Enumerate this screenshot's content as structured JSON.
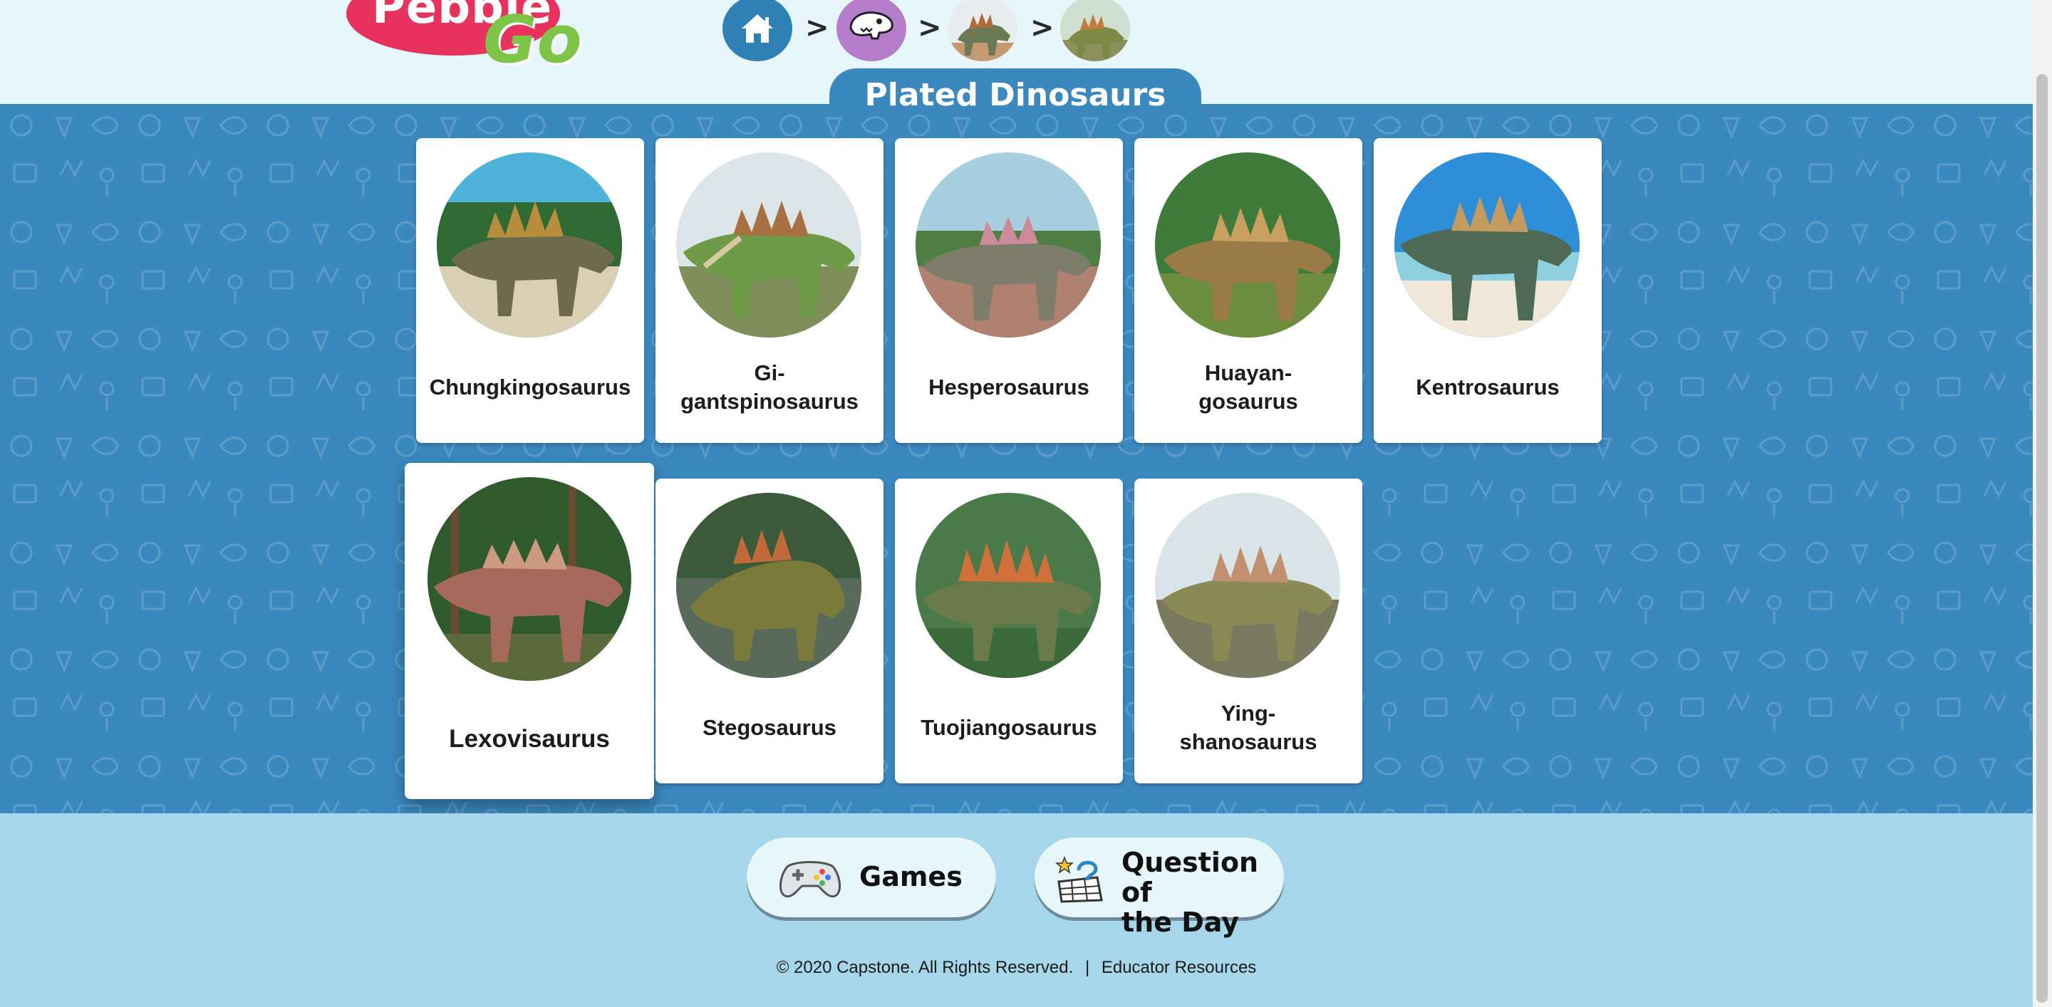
{
  "brand": {
    "logo_top": "Pebble",
    "logo_bottom": "Go"
  },
  "breadcrumb": {
    "separator": ">",
    "items": [
      {
        "icon": "home-icon"
      },
      {
        "icon": "dinosaur-icon"
      },
      {
        "icon": "plated-dinosaur-thumbnail"
      },
      {
        "icon": "stegosaurus-thumbnail"
      }
    ]
  },
  "page": {
    "title": "Plated Dinosaurs"
  },
  "cards": [
    {
      "name": "Chungkingosaurus"
    },
    {
      "name_lines": [
        "Gi-",
        "gantspinosaurus"
      ]
    },
    {
      "name": "Hesperosaurus"
    },
    {
      "name_lines": [
        "Huayan-",
        "gosaurus"
      ]
    },
    {
      "name": "Kentrosaurus"
    },
    {
      "name": "Lexovisaurus"
    },
    {
      "name": "Stegosaurus"
    },
    {
      "name": "Tuojiangosaurus"
    },
    {
      "name_lines": [
        "Ying-",
        "shanosaurus"
      ]
    }
  ],
  "footer": {
    "games_label": "Games",
    "qotd_lines": [
      "Question of",
      "the Day"
    ],
    "copyright": "© 2020 Capstone. All Rights Reserved.",
    "divider": "|",
    "educator_link": "Educator Resources"
  },
  "colors": {
    "main_bg": "#3b88bf",
    "header_bg": "#e6f6fb",
    "footer_bg": "#a5d6ea",
    "logo_red": "#e8325e",
    "logo_green": "#7ec447"
  }
}
